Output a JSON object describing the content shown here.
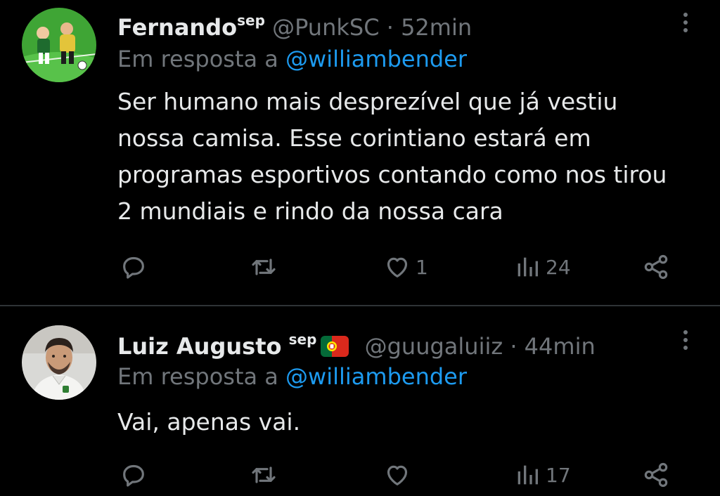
{
  "tweets": [
    {
      "display_name": "Fernando",
      "name_suffix": "sep",
      "handle": "@PunkSC",
      "separator": "·",
      "time": "52min",
      "reply_prefix": "Em resposta a",
      "reply_to": "@williambender",
      "text": "Ser humano mais desprezível que já vestiu nossa camisa. Esse corintiano estará em programas esportivos contando como nos tirou 2 mundiais e rindo da nossa cara",
      "likes": "1",
      "views": "24",
      "avatar_icon": "cartoon-soccer-players-avatar"
    },
    {
      "display_name": "Luiz Augusto",
      "name_suffix": "sep",
      "flag_icon": "portugal-flag-icon",
      "handle": "@guugaluiiz",
      "separator": "·",
      "time": "44min",
      "reply_prefix": "Em resposta a",
      "reply_to": "@williambender",
      "text": "Vai, apenas vai.",
      "likes": "",
      "views": "17",
      "avatar_icon": "user-photo-avatar"
    }
  ],
  "colors": {
    "background": "#000000",
    "text_primary": "#e7e9ea",
    "text_secondary": "#71767b",
    "link": "#1d9bf0",
    "divider": "#2f3336"
  }
}
